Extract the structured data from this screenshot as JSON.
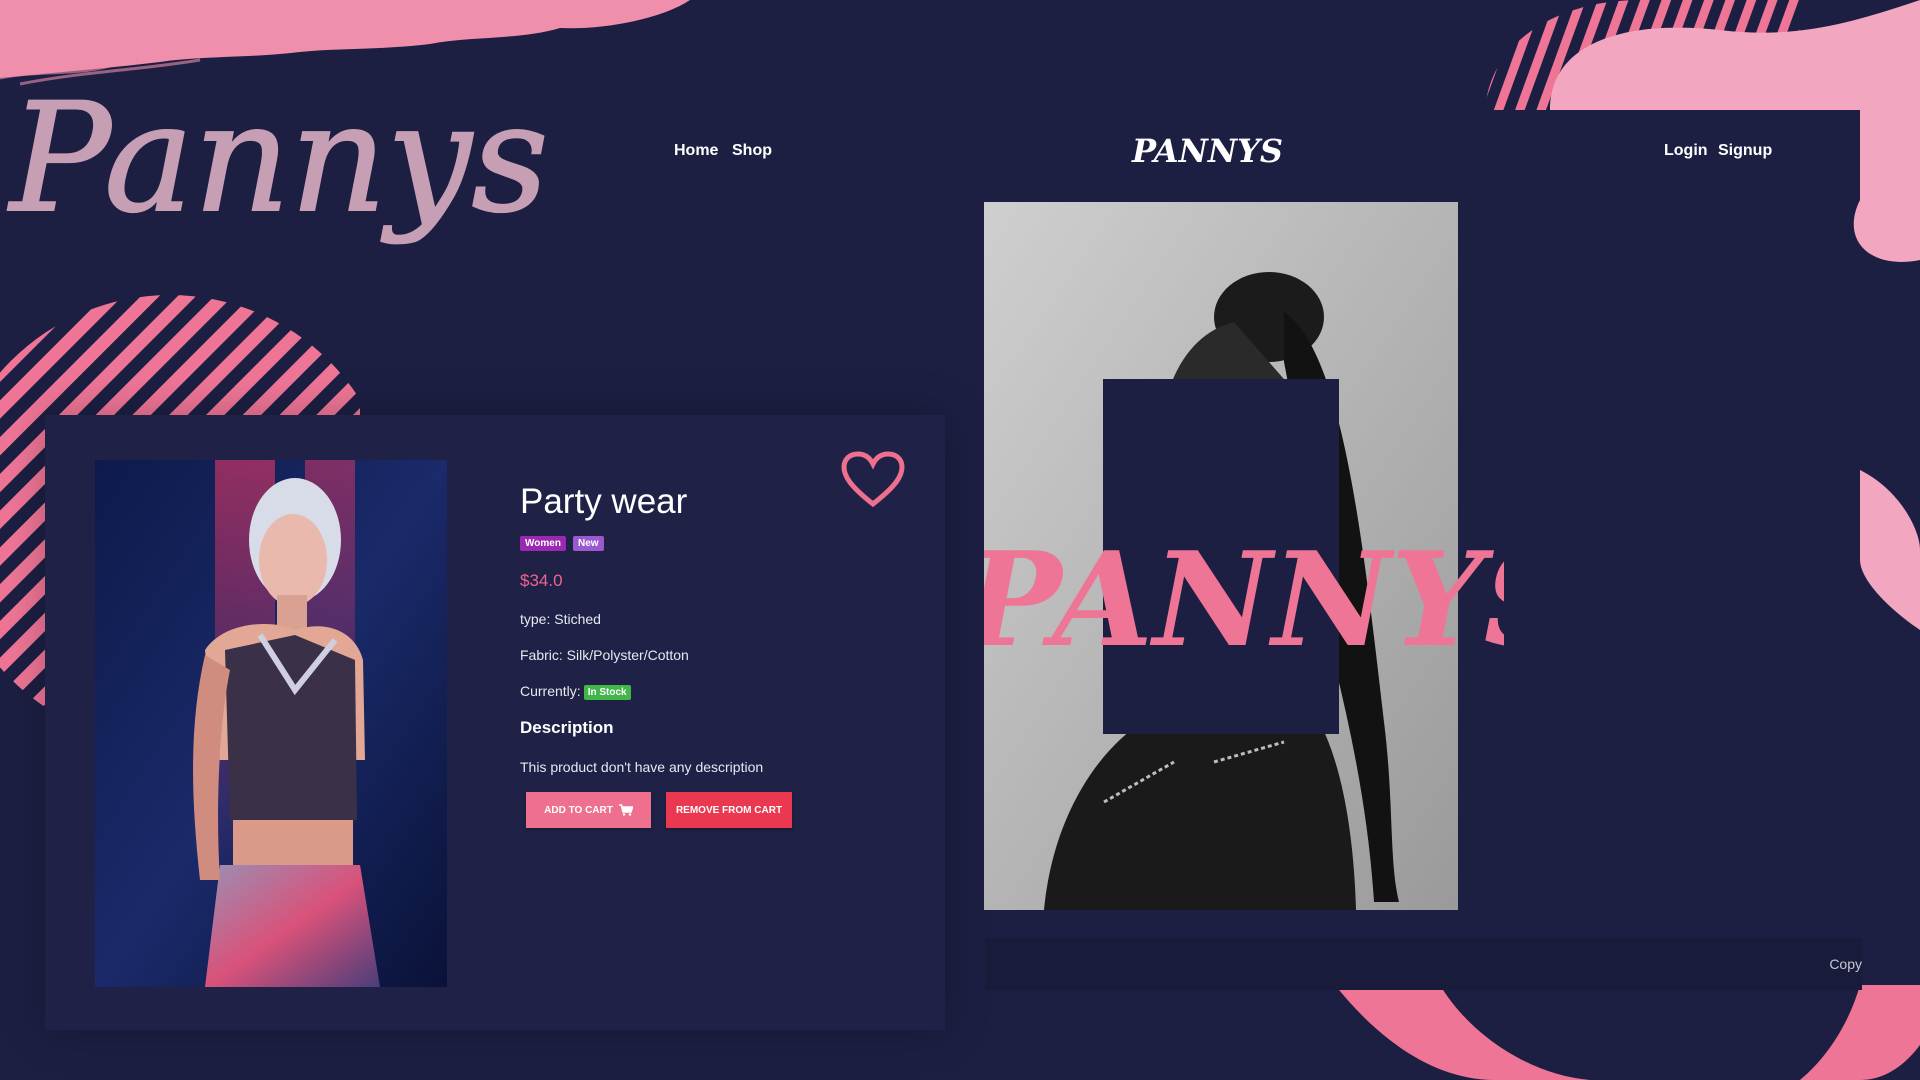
{
  "nav": {
    "links_left": [
      "Home",
      "Shop"
    ],
    "links_right": [
      "Login",
      "Signup"
    ],
    "brand_logo_text": "PANNYS"
  },
  "decor": {
    "script_logo_text": "Pannys",
    "hero_script_text": "PANNYS"
  },
  "product": {
    "title": "Party wear",
    "badges": [
      "Women",
      "New"
    ],
    "price": "$34.0",
    "type_line": "type: Stiched",
    "fabric_line": "Fabric: Silk/Polyster/Cotton",
    "currently_label": "Currently:",
    "stock_status": "In Stock",
    "description_heading": "Description",
    "description_text": "This product don't have any description",
    "add_to_cart_label": "ADD TO CART",
    "remove_from_cart_label": "REMOVE FROM CART"
  },
  "footer": {
    "copy_text": "Copy"
  },
  "colors": {
    "background": "#1c1f42",
    "pink_accent": "#ef7596",
    "price": "#f06292",
    "add_button": "#ef6f8e",
    "remove_button": "#e9384f",
    "stock_badge": "#43b649",
    "badge_women": "#9b28b0",
    "badge_new": "#9b59d0"
  },
  "icons": [
    "heart-icon",
    "cart-icon"
  ]
}
